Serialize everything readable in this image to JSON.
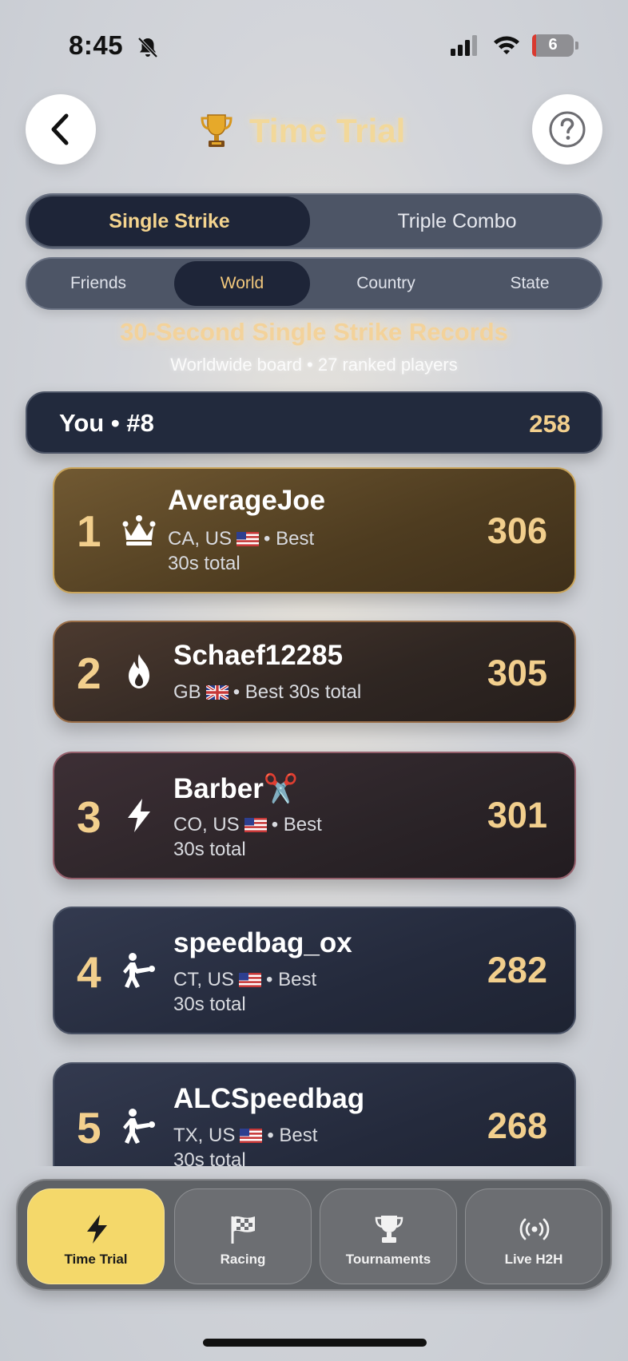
{
  "status_bar": {
    "time": "8:45",
    "battery": "6"
  },
  "header": {
    "title": "Time Trial",
    "trophy_icon": "trophy-icon",
    "back_icon": "chevron-left-icon",
    "help_icon": "question-mark-icon"
  },
  "mode_tabs": [
    {
      "label": "Single Strike",
      "selected": true
    },
    {
      "label": "Triple Combo",
      "selected": false
    }
  ],
  "scope_tabs": [
    {
      "label": "Friends",
      "selected": false
    },
    {
      "label": "World",
      "selected": true
    },
    {
      "label": "Country",
      "selected": false
    },
    {
      "label": "State",
      "selected": false
    }
  ],
  "board": {
    "title": "30-Second Single Strike Records",
    "subtitle": "Worldwide board • 27 ranked players"
  },
  "you": {
    "label": "You • #8",
    "score": "258"
  },
  "leaderboard": [
    {
      "rank": "1",
      "icon": "crown-icon",
      "name": "AverageJoe",
      "location": "CA, US",
      "flag": "us-flag-icon",
      "line1_suffix": "• Best",
      "line2": "30s total",
      "score": "306"
    },
    {
      "rank": "2",
      "icon": "flame-icon",
      "name": "Schaef12285",
      "location": "GB",
      "flag": "uk-flag-icon",
      "line1_suffix": "• Best 30s total",
      "line2": "",
      "score": "305"
    },
    {
      "rank": "3",
      "icon": "lightning-icon",
      "name": "Barber✂️",
      "location": "CO, US",
      "flag": "us-flag-icon",
      "line1_suffix": "• Best",
      "line2": "30s total",
      "score": "301"
    },
    {
      "rank": "4",
      "icon": "boxer-icon",
      "name": "speedbag_ox",
      "location": "CT, US",
      "flag": "us-flag-icon",
      "line1_suffix": "• Best",
      "line2": "30s total",
      "score": "282"
    },
    {
      "rank": "5",
      "icon": "boxer-icon",
      "name": "ALCSpeedbag",
      "location": "TX, US",
      "flag": "us-flag-icon",
      "line1_suffix": "• Best",
      "line2": "30s total",
      "score": "268"
    }
  ],
  "tabbar": [
    {
      "label": "Time Trial",
      "icon": "lightning-icon",
      "active": true
    },
    {
      "label": "Racing",
      "icon": "checkered-flag-icon",
      "active": false
    },
    {
      "label": "Tournaments",
      "icon": "trophy-icon",
      "active": false
    },
    {
      "label": "Live H2H",
      "icon": "broadcast-icon",
      "active": false
    }
  ],
  "colors": {
    "accent_gold": "#f2cf8d",
    "active_tab": "#f4d86a",
    "dark_navy": "#1e2538"
  }
}
